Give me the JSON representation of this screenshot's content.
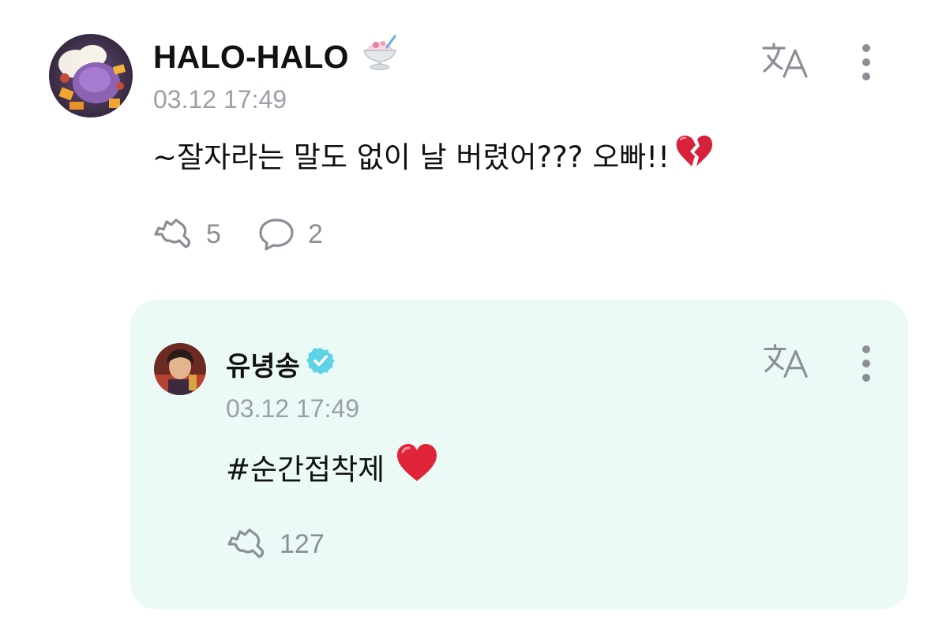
{
  "post": {
    "username": "HALO-HALO",
    "username_emoji": "shaved-ice-icon",
    "timestamp": "03.12 17:49",
    "text": "~잘자라는 말도 없이 날 버렸어??? 오빠!!",
    "text_emoji": "broken-heart-icon",
    "like_count": "5",
    "comment_count": "2"
  },
  "reply": {
    "username": "유녕송",
    "verified": true,
    "timestamp": "03.12 17:49",
    "text": "#순간접착제",
    "text_emoji": "red-heart-icon",
    "like_count": "127"
  },
  "colors": {
    "reply_background": "#ebfaf6",
    "verified_badge": "#5fd3e6",
    "icon_gray": "#8a8f95",
    "timestamp_gray": "#9aa0a6"
  }
}
